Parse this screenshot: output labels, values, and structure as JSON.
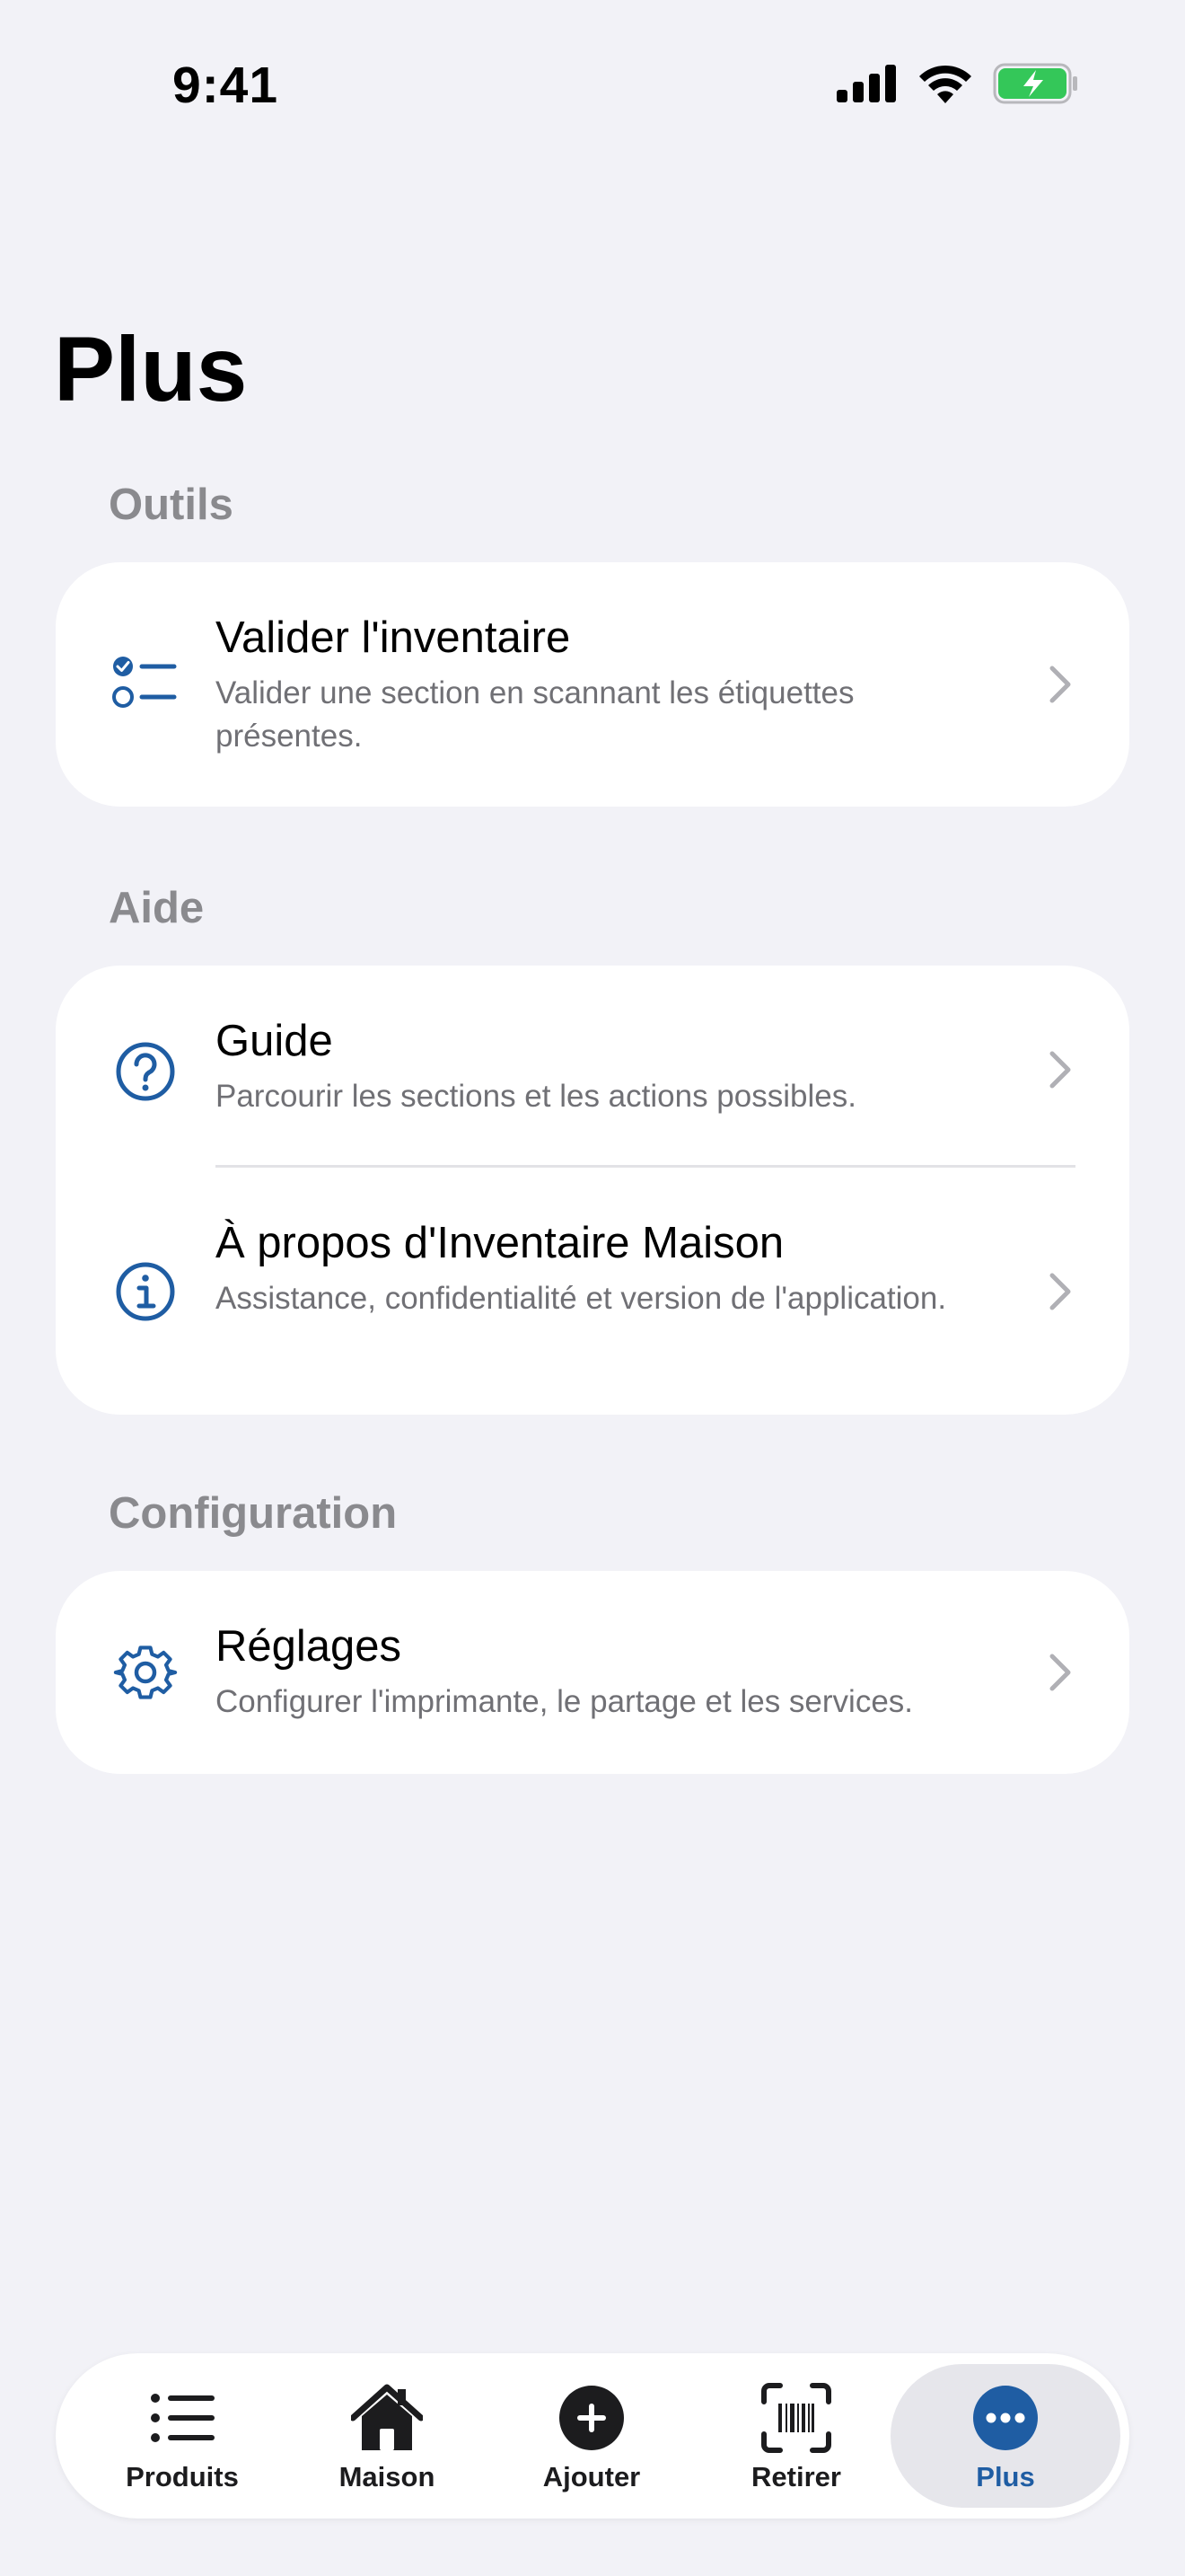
{
  "status": {
    "time": "9:41"
  },
  "page": {
    "title": "Plus"
  },
  "sections": {
    "tools": {
      "header": "Outils",
      "items": [
        {
          "title": "Valider l'inventaire",
          "subtitle": "Valider une section en scannant les étiquettes présentes.",
          "icon": "checklist-icon"
        }
      ]
    },
    "help": {
      "header": "Aide",
      "items": [
        {
          "title": "Guide",
          "subtitle": "Parcourir les sections et les actions possibles.",
          "icon": "question-circle-icon"
        },
        {
          "title": "À propos d'Inventaire Maison",
          "subtitle": "Assistance, confidentialité et version de l'application.",
          "icon": "info-circle-icon"
        }
      ]
    },
    "config": {
      "header": "Configuration",
      "items": [
        {
          "title": "Réglages",
          "subtitle": "Configurer l'imprimante, le partage et les services.",
          "icon": "gear-icon"
        }
      ]
    }
  },
  "tabbar": {
    "items": [
      {
        "label": "Produits",
        "icon": "list-icon"
      },
      {
        "label": "Maison",
        "icon": "house-icon"
      },
      {
        "label": "Ajouter",
        "icon": "plus-circle-icon"
      },
      {
        "label": "Retirer",
        "icon": "barcode-scan-icon"
      },
      {
        "label": "Plus",
        "icon": "ellipsis-circle-icon",
        "active": true
      }
    ]
  },
  "colors": {
    "accent": "#1f5da3",
    "background": "#f2f2f7",
    "card": "#ffffff",
    "secondary_text": "#707075",
    "section_header": "#8a8a8e",
    "battery": "#34c759"
  }
}
